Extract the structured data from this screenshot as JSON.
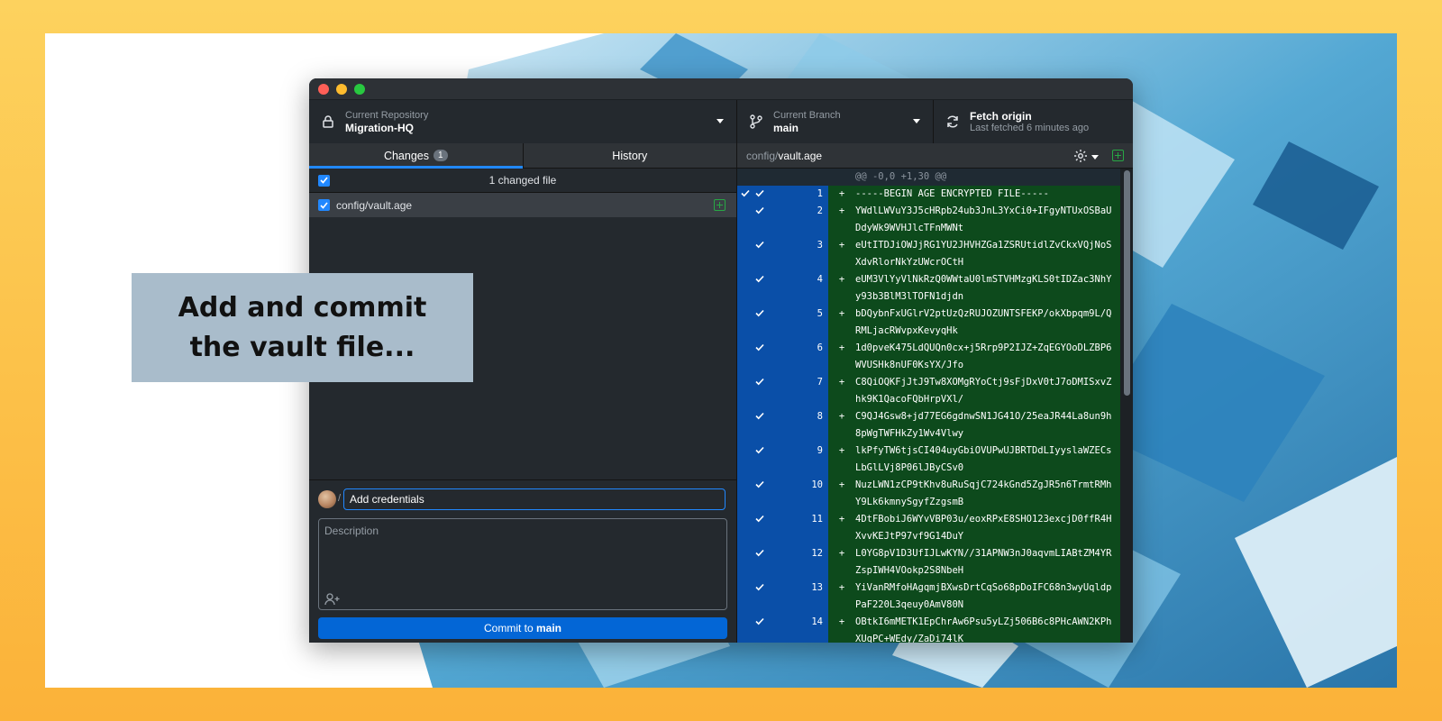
{
  "callout": {
    "line1": "Add and commit",
    "line2": "the vault file..."
  },
  "toolbar": {
    "repo_label": "Current Repository",
    "repo_value": "Migration-HQ",
    "branch_label": "Current Branch",
    "branch_value": "main",
    "fetch_label": "Fetch origin",
    "fetch_sub": "Last fetched 6 minutes ago"
  },
  "tabs": {
    "changes": "Changes",
    "changes_count": "1",
    "history": "History"
  },
  "files": {
    "header": "1 changed file",
    "items": [
      "config/vault.age"
    ]
  },
  "commit": {
    "summary_value": "Add credentials",
    "description_placeholder": "Description",
    "button_prefix": "Commit to ",
    "button_branch": "main"
  },
  "diff": {
    "path_dir": "config/",
    "path_file": "vault.age",
    "hunk": "@@ -0,0 +1,30 @@",
    "lines": [
      {
        "n": "1",
        "text": "-----BEGIN AGE ENCRYPTED FILE-----"
      },
      {
        "n": "2",
        "text": "YWdlLWVuY3J5cHRpb24ub3JnL3YxCi0+IFgyNTUxOSBaUDdyWk9WVHJlcTFnMWNt"
      },
      {
        "n": "3",
        "text": "eUtITDJiOWJjRG1YU2JHVHZGa1ZSRUtidlZvCkxVQjNoSXdvRlorNkYzUWcrOCtH"
      },
      {
        "n": "4",
        "text": "eUM3VlYyVlNkRzQ0WWtaU0lmSTVHMzgKLS0tIDZac3NhYy93b3BlM3lTOFN1djdn"
      },
      {
        "n": "5",
        "text": "bDQybnFxUGlrV2ptUzQzRUJOZUNTSFEKP/okXbpqm9L/QRMLjacRWvpxKevyqHk"
      },
      {
        "n": "6",
        "text": "1d0pveK475LdQUQn0cx+j5Rrp9P2IJZ+ZqEGYOoDLZBP6WVUSHk8nUF0KsYX/Jfo"
      },
      {
        "n": "7",
        "text": "C8QiOQKFjJtJ9Tw8XOMgRYoCtj9sFjDxV0tJ7oDMISxvZhk9K1QacoFQbHrpVXl/"
      },
      {
        "n": "8",
        "text": "C9QJ4Gsw8+jd77EG6gdnwSN1JG41O/25eaJR44La8un9h8pWgTWFHkZy1Wv4Vlwy"
      },
      {
        "n": "9",
        "text": "lkPfyTW6tjsCI404uyGbiOVUPwUJBRTDdLIyyslaWZECsLbGlLVj8P06lJByCSv0"
      },
      {
        "n": "10",
        "text": "NuzLWN1zCP9tKhv8uRuSqjC724kGnd5ZgJR5n6TrmtRMhY9Lk6kmnySgyfZzgsmB"
      },
      {
        "n": "11",
        "text": "4DtFBobiJ6WYvVBP03u/eoxRPxE8SHO123excjD0ffR4HXvvKEJtP97vf9G14DuY"
      },
      {
        "n": "12",
        "text": "L0YG8pV1D3UfIJLwKYN//31APNW3nJ0aqvmLIABtZM4YRZspIWH4VOokp2S8NbeH"
      },
      {
        "n": "13",
        "text": "YiVanRMfoHAgqmjBXwsDrtCqSo68pDoIFC68n3wyUqldpPaF220L3qeuy0AmV80N"
      },
      {
        "n": "14",
        "text": "OBtkI6mMETK1EpChrAw6Psu5yLZj506B6c8PHcAWN2KPhXUqPC+WEdy/ZaDi74lK"
      }
    ]
  }
}
